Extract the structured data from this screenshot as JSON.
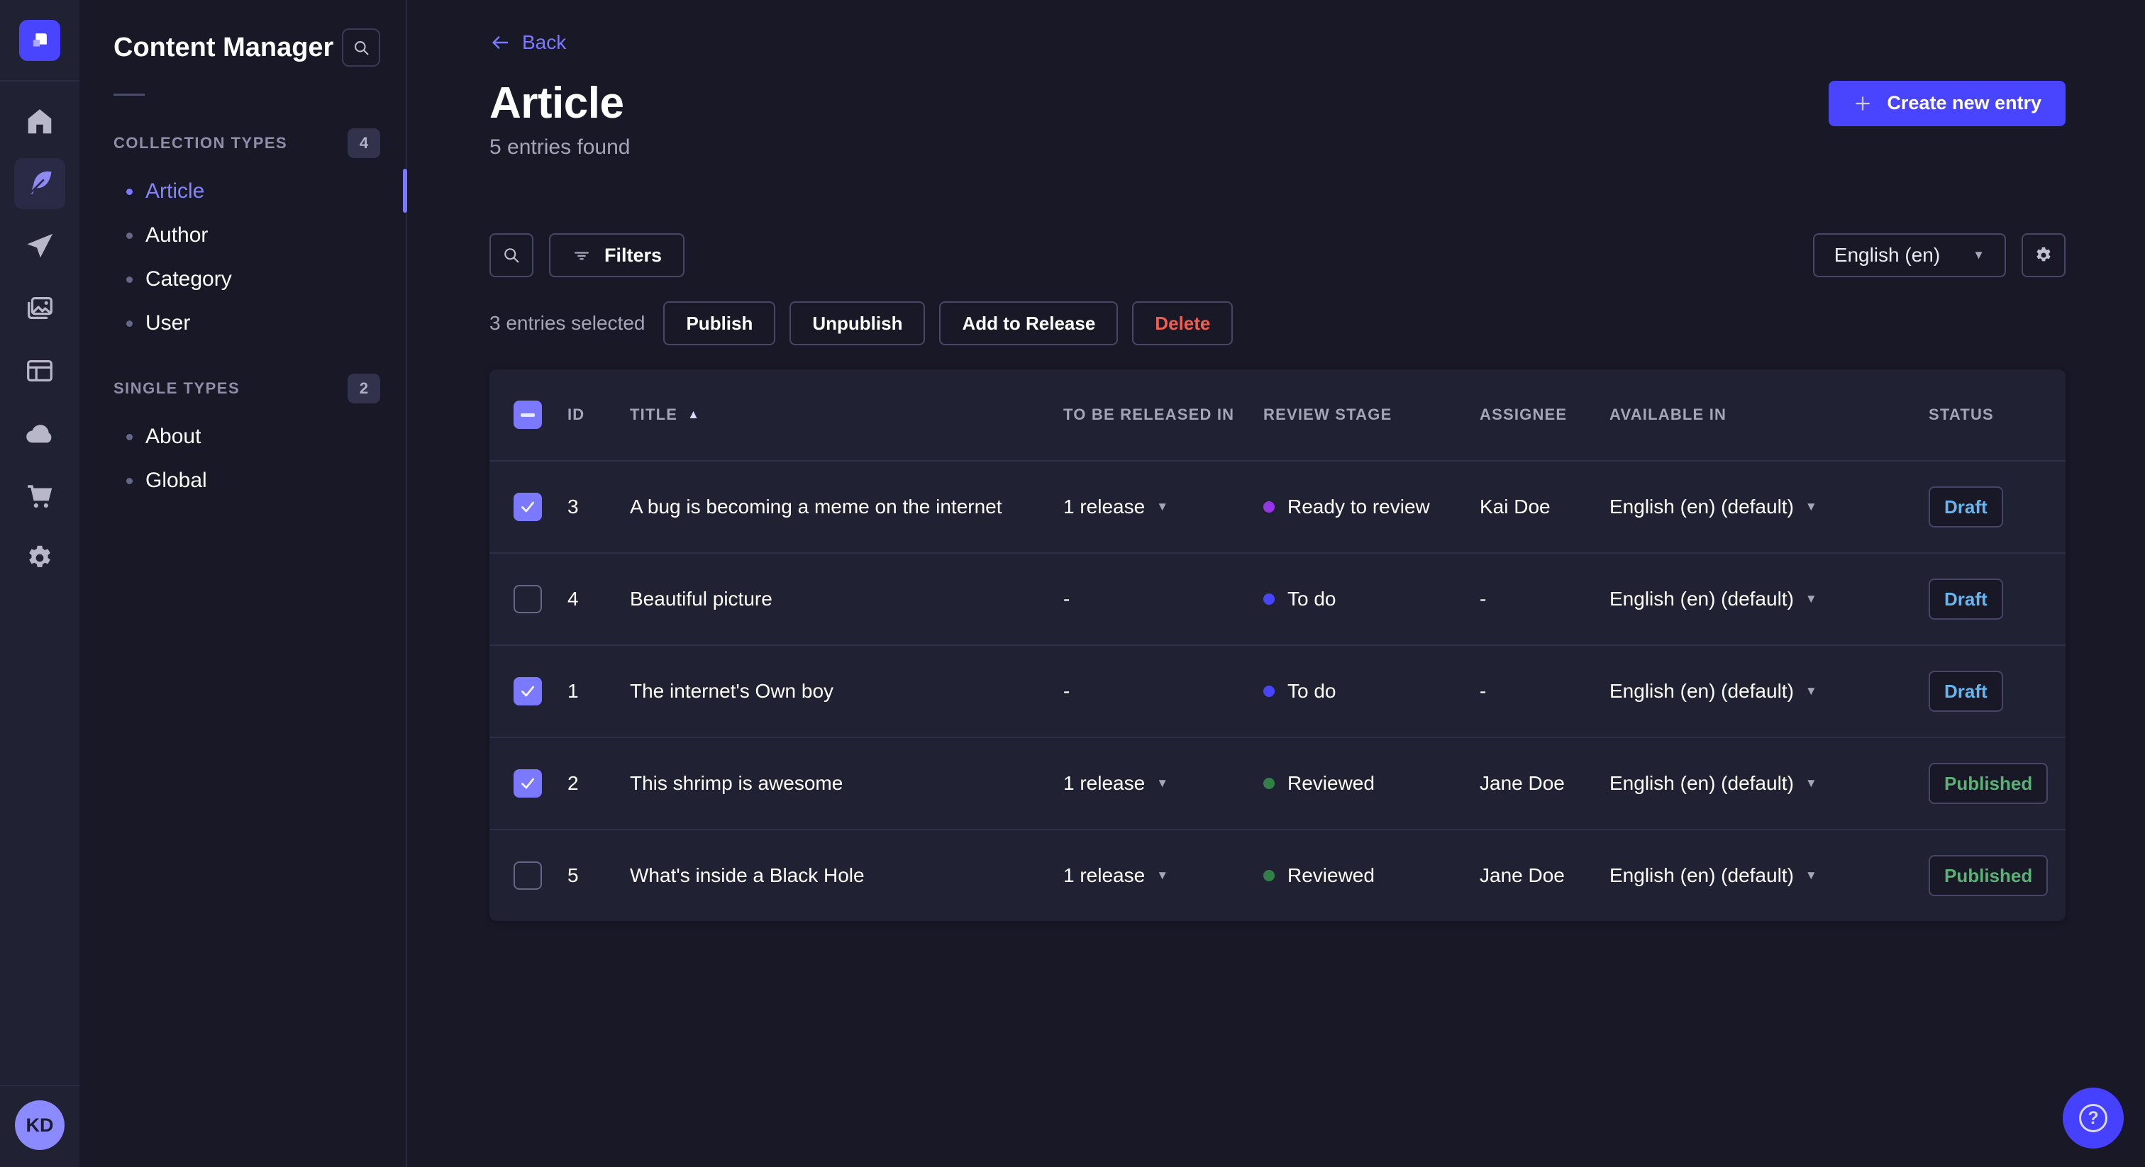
{
  "subnav": {
    "title": "Content Manager",
    "sections": [
      {
        "label": "COLLECTION TYPES",
        "count": "4",
        "items": [
          {
            "label": "Article",
            "active": true
          },
          {
            "label": "Author"
          },
          {
            "label": "Category"
          },
          {
            "label": "User"
          }
        ]
      },
      {
        "label": "SINGLE TYPES",
        "count": "2",
        "items": [
          {
            "label": "About"
          },
          {
            "label": "Global"
          }
        ]
      }
    ]
  },
  "header": {
    "back_label": "Back",
    "title": "Article",
    "subtitle": "5 entries found",
    "create_button": "Create new entry"
  },
  "toolbar": {
    "filters_label": "Filters",
    "locale": "English (en)"
  },
  "selection": {
    "text": "3 entries selected",
    "publish": "Publish",
    "unpublish": "Unpublish",
    "add_to_release": "Add to Release",
    "delete": "Delete"
  },
  "table": {
    "headers": {
      "id": "ID",
      "title": "TITLE",
      "release": "TO BE RELEASED IN",
      "review": "REVIEW STAGE",
      "assignee": "ASSIGNEE",
      "available": "AVAILABLE IN",
      "status": "STATUS"
    },
    "rows": [
      {
        "checked": true,
        "id": "3",
        "title": "A bug is becoming a meme on the internet",
        "release": "1 release",
        "review": "Ready to review",
        "review_color": "#9736e8",
        "assignee": "Kai Doe",
        "available": "English (en) (default)",
        "status": "Draft",
        "status_variant": "draft"
      },
      {
        "checked": false,
        "id": "4",
        "title": "Beautiful picture",
        "release": "-",
        "review": "To do",
        "review_color": "#4945ff",
        "assignee": "-",
        "available": "English (en) (default)",
        "status": "Draft",
        "status_variant": "draft"
      },
      {
        "checked": true,
        "id": "1",
        "title": "The internet's Own boy",
        "release": "-",
        "review": "To do",
        "review_color": "#4945ff",
        "assignee": "-",
        "available": "English (en) (default)",
        "status": "Draft",
        "status_variant": "draft"
      },
      {
        "checked": true,
        "id": "2",
        "title": "This shrimp is awesome",
        "release": "1 release",
        "review": "Reviewed",
        "review_color": "#328048",
        "assignee": "Jane Doe",
        "available": "English (en) (default)",
        "status": "Published",
        "status_variant": "published"
      },
      {
        "checked": false,
        "id": "5",
        "title": "What's inside a Black Hole",
        "release": "1 release",
        "review": "Reviewed",
        "review_color": "#328048",
        "assignee": "Jane Doe",
        "available": "English (en) (default)",
        "status": "Published",
        "status_variant": "published"
      }
    ]
  },
  "user": {
    "initials": "KD"
  },
  "icons": {
    "caret_down": "▼",
    "sort_ascending": "▲",
    "help": "?"
  },
  "colors": {
    "accent": "#4945ff",
    "link": "#7b79ff",
    "draft": "#66b7f1",
    "published": "#5cb176",
    "stage_todo": "#4945ff",
    "stage_ready": "#9736e8",
    "stage_reviewed": "#328048"
  }
}
